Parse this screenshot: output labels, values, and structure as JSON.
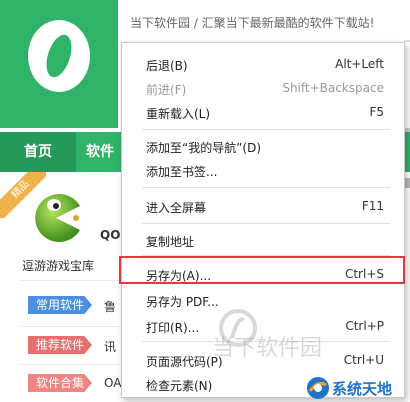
{
  "site": {
    "slogan": "当下软件园 / 汇聚当下最新最酷的软件下载站!",
    "nav": {
      "home": "首页",
      "software": "软件"
    },
    "ribbon": "精品",
    "partial_qo": "QO",
    "featured": {
      "label": "逗游游戏宝库",
      "label2": "OA"
    },
    "tags": [
      {
        "label": "常用软件",
        "after": "鲁",
        "color": "#4a90e2"
      },
      {
        "label": "推荐软件",
        "after": "讯",
        "color": "#e76f6f"
      },
      {
        "label": "软件合集",
        "after": "OA",
        "color": "#f08585"
      }
    ]
  },
  "menu": {
    "items": [
      {
        "label": "后退(B)",
        "shortcut": "Alt+Left",
        "disabled": false
      },
      {
        "label": "前进(F)",
        "shortcut": "Shift+Backspace",
        "disabled": true
      },
      {
        "label": "重新载入(L)",
        "shortcut": "F5",
        "disabled": false
      },
      {
        "label": "添加至“我的导航”(D)",
        "shortcut": "",
        "disabled": false
      },
      {
        "label": "添加至书签...",
        "shortcut": "",
        "disabled": false
      },
      {
        "label": "进入全屏幕",
        "shortcut": "F11",
        "disabled": false
      },
      {
        "label": "复制地址",
        "shortcut": "",
        "disabled": false
      },
      {
        "label": "另存为(A)...",
        "shortcut": "Ctrl+S",
        "disabled": false
      },
      {
        "label": "另存为 PDF...",
        "shortcut": "",
        "disabled": false
      },
      {
        "label": "打印(R)...",
        "shortcut": "Ctrl+P",
        "disabled": false
      },
      {
        "label": "页面源代码(P)",
        "shortcut": "Ctrl+U",
        "disabled": false
      },
      {
        "label": "检查元素(N)",
        "shortcut": "",
        "disabled": false
      }
    ]
  },
  "watermarks": {
    "downxia": "当下软件园",
    "xitong": "系统天地"
  },
  "colors": {
    "brand_green": "#2fb369",
    "highlight_red": "#e23a3a",
    "watermark_blue": "#1e72c9"
  }
}
